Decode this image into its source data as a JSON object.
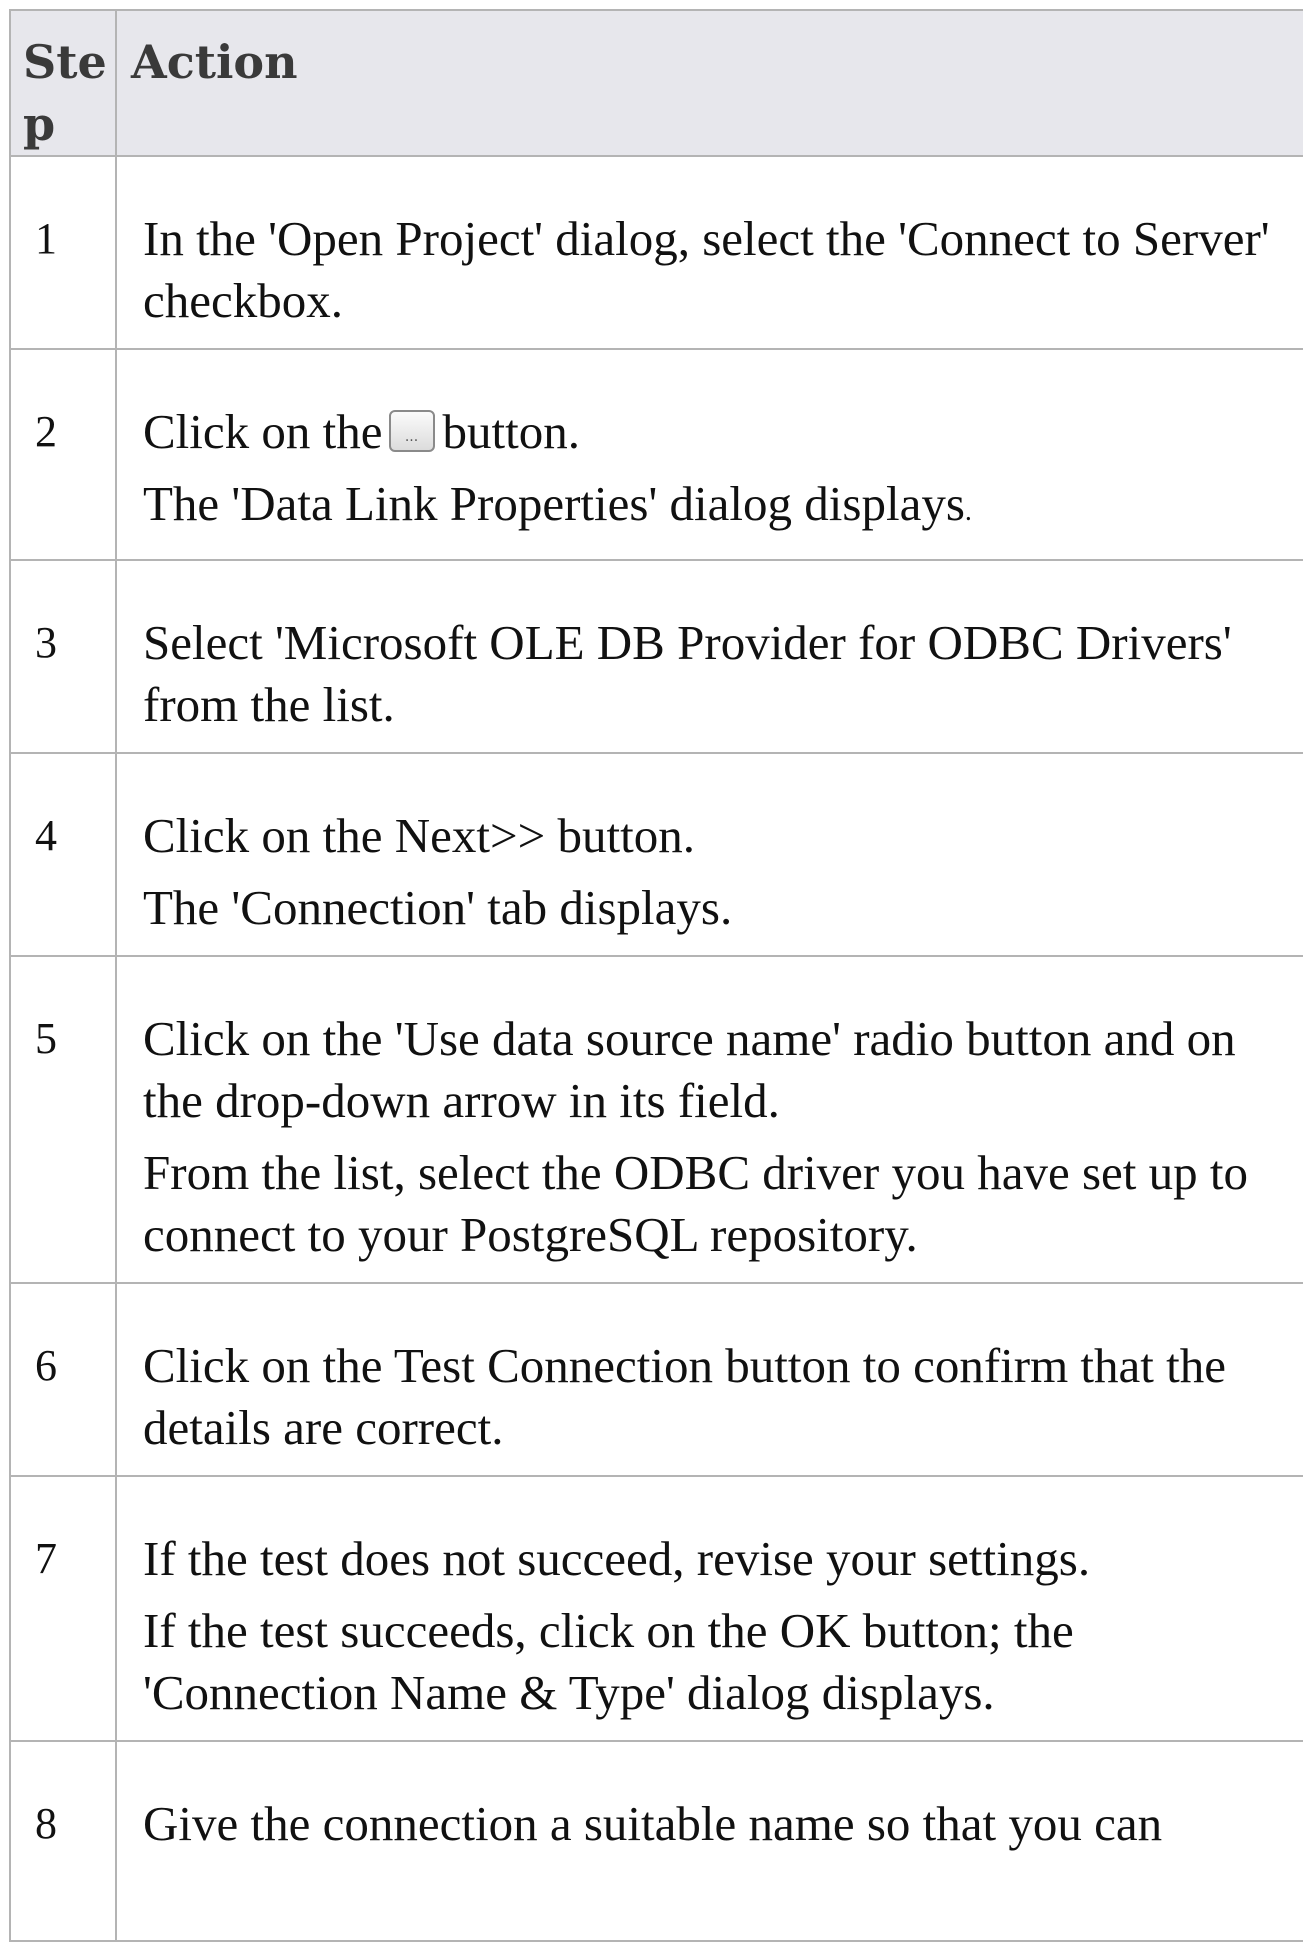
{
  "header": {
    "step": "Step",
    "action": "Action"
  },
  "steps": [
    {
      "num": "1",
      "lines": [
        "In the 'Open Project' dialog, select the 'Connect to Server' checkbox."
      ]
    },
    {
      "num": "2",
      "before_button": "Click on the",
      "button_glyph": "...",
      "after_button": "button.",
      "line2_main": "The 'Data Link Properties' dialog displays",
      "line2_tail": "."
    },
    {
      "num": "3",
      "lines": [
        "Select 'Microsoft OLE DB Provider for ODBC Drivers' from the list."
      ]
    },
    {
      "num": "4",
      "lines": [
        "Click on the Next>> button.",
        "The 'Connection' tab displays."
      ]
    },
    {
      "num": "5",
      "lines": [
        "Click on the 'Use data source name' radio button and on the drop-down arrow in its field.",
        "From the list, select the ODBC driver you have set up to connect to your PostgreSQL repository."
      ]
    },
    {
      "num": "6",
      "lines": [
        "Click on the Test Connection button to confirm that the details are correct."
      ]
    },
    {
      "num": "7",
      "lines": [
        "If the test does not succeed, revise your settings.",
        "If the test succeeds, click on the OK button; the 'Connection Name & Type' dialog displays."
      ]
    },
    {
      "num": "8",
      "lines": [
        "Give the connection a suitable name so that you can"
      ]
    }
  ]
}
